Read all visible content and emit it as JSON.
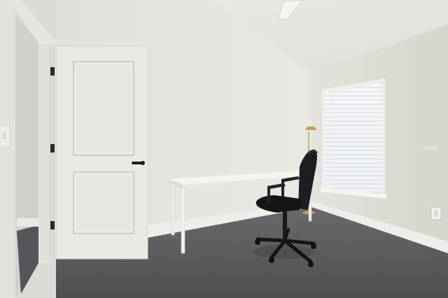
{
  "scene": {
    "description_visible_text": {
      "watermark": "Stellar"
    },
    "colors": {
      "wall_back": "#e6e4df",
      "wall_right": "#dedcd6",
      "ceiling": "#ecebe7",
      "carpet": "#5a5a5c",
      "door": "#e9e7e2",
      "trim": "#eceae5",
      "desk": "#f1f1ef",
      "chair": "#1c1c1f",
      "window_light": "#f4f6f8"
    },
    "icons": [
      "door-handle-icon",
      "ceiling-fan-icon",
      "outlet-icon",
      "light-switch-icon"
    ]
  }
}
